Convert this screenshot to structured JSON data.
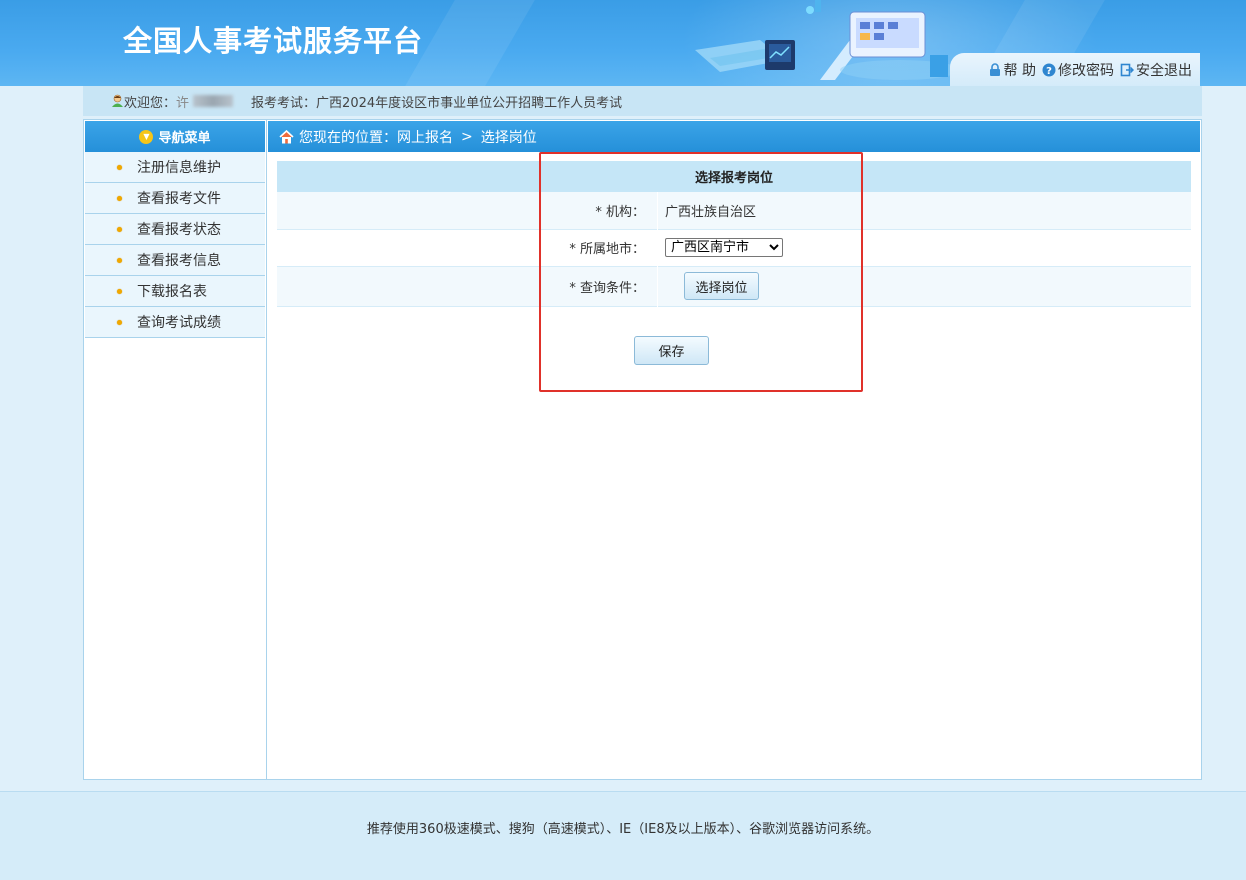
{
  "header": {
    "title": "全国人事考试服务平台",
    "links": [
      {
        "icon": "lock-icon",
        "label": "帮 助"
      },
      {
        "icon": "question-icon",
        "label": "修改密码"
      },
      {
        "icon": "logout-icon",
        "label": "安全退出"
      }
    ]
  },
  "welcome": {
    "greeting_label": "欢迎您：",
    "name_partial": "许",
    "exam_label": "报考考试：",
    "exam_name": "广西2024年度设区市事业单位公开招聘工作人员考试"
  },
  "sidebar": {
    "title": "导航菜单",
    "items": [
      {
        "label": "注册信息维护"
      },
      {
        "label": "查看报考文件"
      },
      {
        "label": "查看报考状态"
      },
      {
        "label": "查看报考信息"
      },
      {
        "label": "下载报名表"
      },
      {
        "label": "查询考试成绩"
      }
    ]
  },
  "breadcrumb": {
    "prefix": "您现在的位置：",
    "level1": "网上报名",
    "separator": ">",
    "level2": "选择岗位"
  },
  "form": {
    "title": "选择报考岗位",
    "org_label": "* 机构：",
    "org_value": "广西壮族自治区",
    "city_label": "* 所属地市：",
    "city_selected": "广西区南宁市",
    "query_label": "* 查询条件：",
    "pick_button": "选择岗位",
    "save_button": "保存"
  },
  "footer": {
    "text": "推荐使用360极速模式、搜狗（高速模式）、IE（IE8及以上版本）、谷歌浏览器访问系统。"
  },
  "colors": {
    "header_blue": "#3a9de6",
    "nav_blue": "#2590d9",
    "highlight_red": "#e0312a"
  }
}
